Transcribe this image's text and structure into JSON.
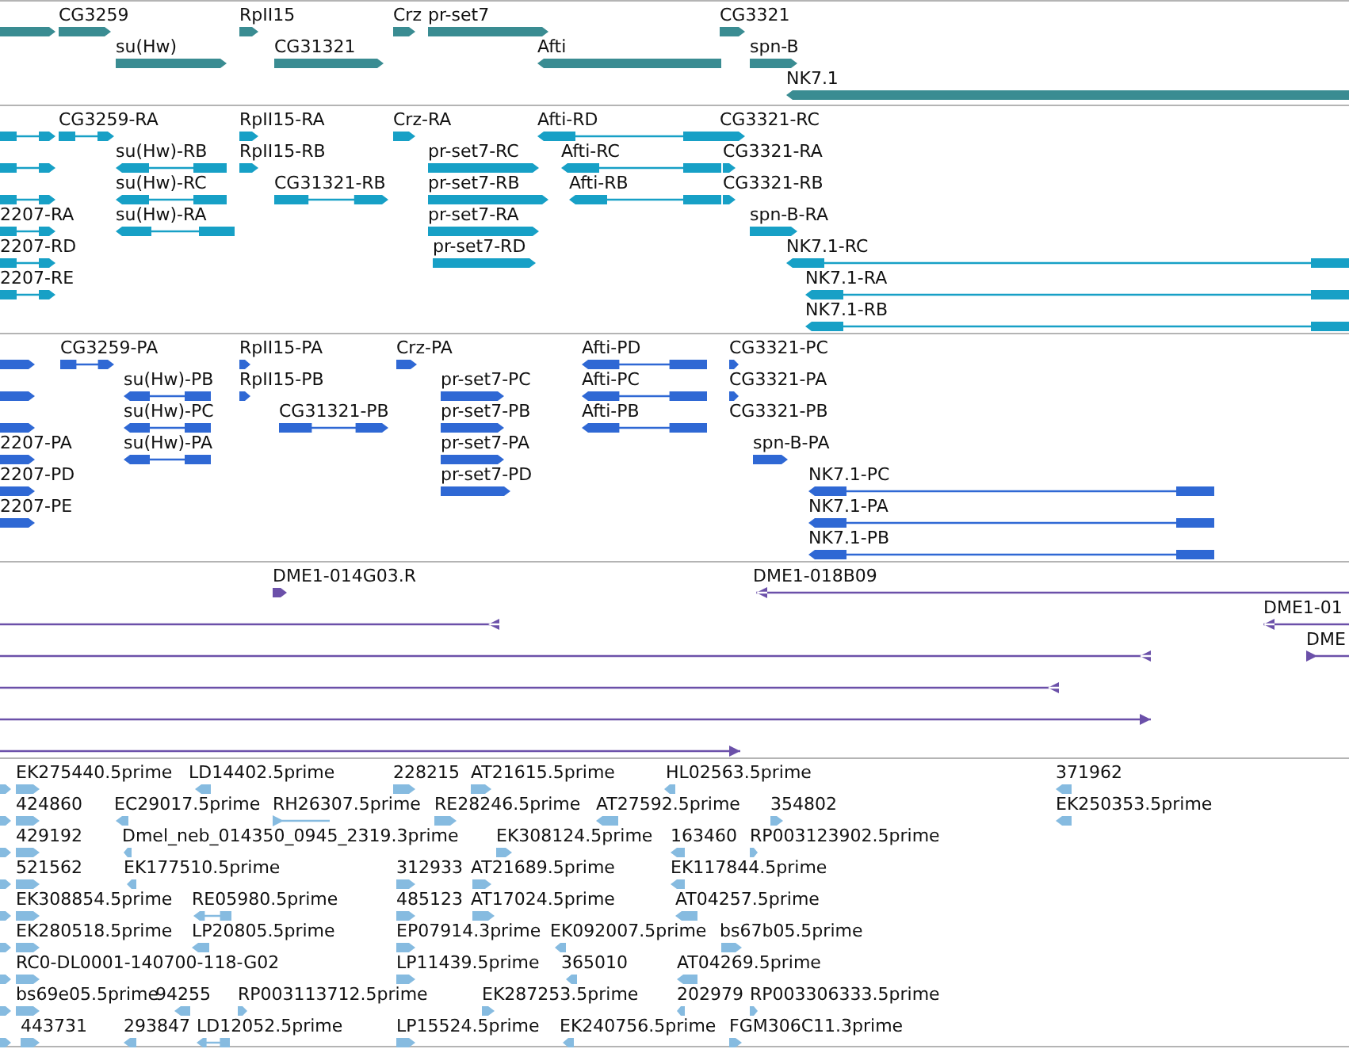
{
  "tracks": [
    {
      "kind": "gene",
      "color": "#3a8c92",
      "features": [
        {
          "reverse": false
        },
        {
          "label": "CG3259",
          "reverse": false
        },
        {
          "label": "su(Hw)",
          "reverse": false
        },
        {
          "label": "RpII15",
          "reverse": false
        },
        {
          "label": "CG31321",
          "reverse": false
        },
        {
          "label": "Crz",
          "reverse": false
        },
        {
          "label": "pr-set7",
          "reverse": false
        },
        {
          "label": "Afti",
          "reverse": true
        },
        {
          "label": "CG3321",
          "reverse": false
        },
        {
          "label": "spn-B",
          "reverse": false
        },
        {
          "label": "NK7.1",
          "reverse": true
        }
      ]
    },
    {
      "kind": "transcript",
      "color": "#17a0c6",
      "features": [
        {
          "reverse": false
        },
        {
          "label": "CG3259-RA",
          "reverse": false
        },
        {
          "label": "RpII15-RA",
          "reverse": false
        },
        {
          "label": "Crz-RA",
          "reverse": false
        },
        {
          "label": "Afti-RD",
          "reverse": true
        },
        {
          "label": "CG3321-RC",
          "reverse": false
        },
        {
          "reverse": false
        },
        {
          "label": "su(Hw)-RB",
          "reverse": true
        },
        {
          "label": "RpII15-RB",
          "reverse": false
        },
        {
          "label": "pr-set7-RC",
          "reverse": false
        },
        {
          "label": "Afti-RC",
          "reverse": true
        },
        {
          "label": "CG3321-RA",
          "reverse": false
        },
        {
          "reverse": false
        },
        {
          "label": "su(Hw)-RC",
          "reverse": true
        },
        {
          "label": "CG31321-RB",
          "reverse": false
        },
        {
          "label": "pr-set7-RB",
          "reverse": false
        },
        {
          "label": "Afti-RB",
          "reverse": true
        },
        {
          "label": "CG3321-RB",
          "reverse": false
        },
        {
          "label": "2207-RA",
          "reverse": false
        },
        {
          "label": "su(Hw)-RA",
          "reverse": true
        },
        {
          "label": "pr-set7-RA",
          "reverse": false
        },
        {
          "label": "spn-B-RA",
          "reverse": false
        },
        {
          "label": "2207-RD",
          "reverse": false
        },
        {
          "label": "pr-set7-RD",
          "reverse": false
        },
        {
          "label": "NK7.1-RC",
          "reverse": true
        },
        {
          "label": "2207-RE",
          "reverse": false
        },
        {
          "label": "NK7.1-RA",
          "reverse": true
        },
        {
          "label": "NK7.1-RB",
          "reverse": true
        }
      ]
    },
    {
      "kind": "protein",
      "color": "#2f68d4",
      "features": [
        {
          "reverse": false
        },
        {
          "label": "CG3259-PA",
          "reverse": false
        },
        {
          "label": "RpII15-PA",
          "reverse": false
        },
        {
          "label": "Crz-PA",
          "reverse": false
        },
        {
          "label": "Afti-PD",
          "reverse": true
        },
        {
          "label": "CG3321-PC",
          "reverse": false
        },
        {
          "reverse": false
        },
        {
          "label": "su(Hw)-PB",
          "reverse": true
        },
        {
          "label": "RpII15-PB",
          "reverse": false
        },
        {
          "label": "pr-set7-PC",
          "reverse": false
        },
        {
          "label": "Afti-PC",
          "reverse": true
        },
        {
          "label": "CG3321-PA",
          "reverse": false
        },
        {
          "reverse": false
        },
        {
          "label": "su(Hw)-PC",
          "reverse": true
        },
        {
          "label": "CG31321-PB",
          "reverse": false
        },
        {
          "label": "pr-set7-PB",
          "reverse": false
        },
        {
          "label": "Afti-PB",
          "reverse": true
        },
        {
          "label": "CG3321-PB"
        },
        {
          "label": "2207-PA",
          "reverse": false
        },
        {
          "label": "su(Hw)-PA",
          "reverse": true
        },
        {
          "label": "pr-set7-PA",
          "reverse": false
        },
        {
          "label": "spn-B-PA",
          "reverse": false
        },
        {
          "label": "2207-PD",
          "reverse": false
        },
        {
          "label": "pr-set7-PD",
          "reverse": false
        },
        {
          "label": "NK7.1-PC",
          "reverse": true
        },
        {
          "label": "2207-PE",
          "reverse": false
        },
        {
          "label": "NK7.1-PA",
          "reverse": true
        },
        {
          "label": "NK7.1-PB",
          "reverse": true
        }
      ]
    },
    {
      "kind": "clone",
      "color": "#6b50a9",
      "features": [
        {
          "label": "DME1-014G03.R",
          "reverse": false
        },
        {
          "label": "DME1-018B09",
          "reverse": true
        },
        {
          "reverse": true
        },
        {
          "label": "DME1-01",
          "reverse": true
        },
        {
          "reverse": true
        },
        {
          "label": "DME",
          "reverse": false
        },
        {
          "reverse": true
        },
        {
          "reverse": false
        },
        {
          "reverse": false
        }
      ]
    },
    {
      "kind": "est",
      "color": "#86bbe0",
      "features": [
        {
          "reverse": false
        },
        {
          "label": "EK275440.5prime",
          "reverse": false
        },
        {
          "label": "LD14402.5prime",
          "reverse": true
        },
        {
          "label": "228215",
          "reverse": false
        },
        {
          "label": "AT21615.5prime",
          "reverse": false
        },
        {
          "label": "HL02563.5prime",
          "reverse": true
        },
        {
          "label": "371962",
          "reverse": true
        },
        {
          "reverse": false
        },
        {
          "label": "424860",
          "reverse": false
        },
        {
          "label": "EC29017.5prime",
          "reverse": true
        },
        {
          "label": "RH26307.5prime",
          "reverse": false
        },
        {
          "label": "RE28246.5prime",
          "reverse": false
        },
        {
          "label": "AT27592.5prime",
          "reverse": true
        },
        {
          "label": "354802",
          "reverse": false
        },
        {
          "label": "EK250353.5prime",
          "reverse": true
        },
        {
          "reverse": false
        },
        {
          "label": "429192",
          "reverse": false
        },
        {
          "label": "Dmel_neb_014350_0945_2319.3prime",
          "reverse": true
        },
        {
          "label": "EK308124.5prime",
          "reverse": false
        },
        {
          "label": "163460",
          "reverse": true
        },
        {
          "label": "RP003123902.5prime",
          "reverse": false
        },
        {
          "reverse": false
        },
        {
          "label": "521562",
          "reverse": false
        },
        {
          "label": "EK177510.5prime",
          "reverse": true
        },
        {
          "label": "312933",
          "reverse": false
        },
        {
          "label": "AT21689.5prime",
          "reverse": false
        },
        {
          "label": "EK117844.5prime",
          "reverse": true
        },
        {
          "reverse": false
        },
        {
          "label": "EK308854.5prime",
          "reverse": false
        },
        {
          "label": "RE05980.5prime",
          "reverse": true
        },
        {
          "label": "485123",
          "reverse": false
        },
        {
          "label": "AT17024.5prime",
          "reverse": false
        },
        {
          "label": "AT04257.5prime",
          "reverse": true
        },
        {
          "reverse": false
        },
        {
          "label": "EK280518.5prime",
          "reverse": false
        },
        {
          "label": "LP20805.5prime",
          "reverse": true
        },
        {
          "label": "EP07914.3prime",
          "reverse": false
        },
        {
          "label": "EK092007.5prime",
          "reverse": true
        },
        {
          "label": "bs67b05.5prime",
          "reverse": false
        },
        {
          "reverse": false
        },
        {
          "label": "RC0-DL0001-140700-118-G02",
          "reverse": false
        },
        {
          "label": "LP11439.5prime",
          "reverse": false
        },
        {
          "label": "365010",
          "reverse": true
        },
        {
          "label": "AT04269.5prime",
          "reverse": true
        },
        {
          "reverse": false
        },
        {
          "label": "bs69e05.5prime",
          "reverse": false
        },
        {
          "label": "94255",
          "reverse": true
        },
        {
          "label": "RP003113712.5prime",
          "reverse": false
        },
        {
          "label": "EK287253.5prime",
          "reverse": false
        },
        {
          "label": "202979",
          "reverse": true
        },
        {
          "label": "RP003306333.5prime",
          "reverse": false
        },
        {
          "reverse": false
        },
        {
          "label": "443731",
          "reverse": false
        },
        {
          "label": "293847",
          "reverse": true
        },
        {
          "label": "LD12052.5prime",
          "reverse": true
        },
        {
          "label": "LP15524.5prime",
          "reverse": false
        },
        {
          "label": "EK240756.5prime",
          "reverse": true
        },
        {
          "label": "FGM306C11.3prime",
          "reverse": false
        }
      ]
    }
  ]
}
